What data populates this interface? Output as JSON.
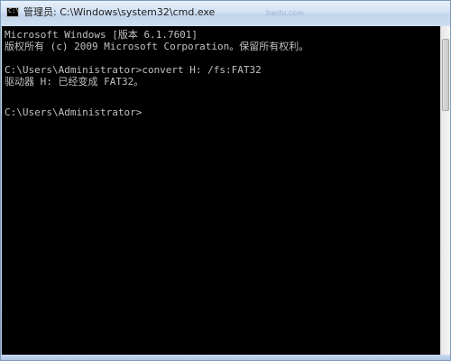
{
  "window": {
    "title": "管理员: C:\\Windows\\system32\\cmd.exe",
    "icon": "cmd-window-icon",
    "icon_glyph": "C:\\"
  },
  "watermark": "baidu.com",
  "console": {
    "lines": [
      "Microsoft Windows [版本 6.1.7601]",
      "版权所有 (c) 2009 Microsoft Corporation。保留所有权利。",
      "C:\\Users\\Administrator>convert H: /fs:FAT32",
      "驱动器 H: 已经变成 FAT32。",
      "C:\\Users\\Administrator>"
    ]
  },
  "colors": {
    "console_background": "#000000",
    "console_text": "#c0c0c0",
    "titlebar": "#d2e1f3"
  }
}
